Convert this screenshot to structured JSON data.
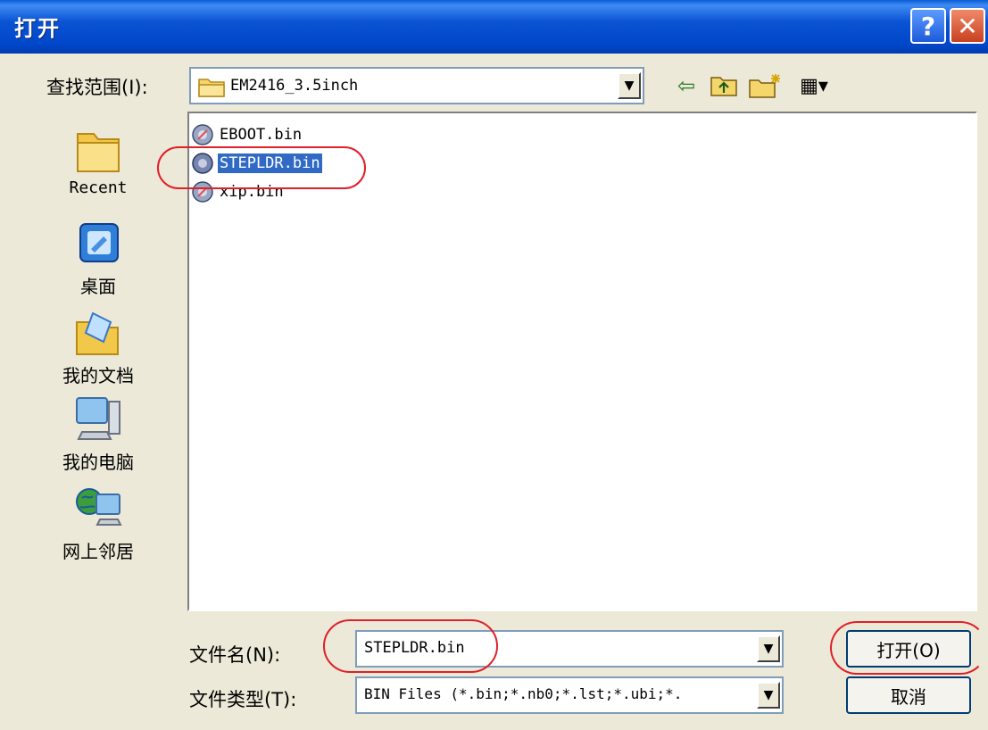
{
  "window": {
    "title": "打开",
    "help_glyph": "?",
    "close_glyph": "✕"
  },
  "lookin": {
    "label": "查找范围(I):",
    "value": "EM2416_3.5inch",
    "dropdown_glyph": "▼"
  },
  "toolbar": {
    "back_glyph": "⇦",
    "up_glyph": "⮤",
    "newfolder_glyph": "✱",
    "view_glyph": "▦▾"
  },
  "places": [
    {
      "label": "Recent",
      "icon": "folder-icon"
    },
    {
      "label": "桌面",
      "icon": "desktop-icon"
    },
    {
      "label": "我的文档",
      "icon": "documents-folder-icon"
    },
    {
      "label": "我的电脑",
      "icon": "computer-icon"
    },
    {
      "label": "网上邻居",
      "icon": "network-icon"
    }
  ],
  "files": [
    {
      "name": "EBOOT.bin",
      "selected": false
    },
    {
      "name": "STEPLDR.bin",
      "selected": true
    },
    {
      "name": "xip.bin",
      "selected": false
    }
  ],
  "filename": {
    "label": "文件名(N):",
    "value": "STEPLDR.bin"
  },
  "filetype": {
    "label": "文件类型(T):",
    "value": "BIN Files (*.bin;*.nb0;*.lst;*.ubi;*."
  },
  "buttons": {
    "open": "打开(O)",
    "cancel": "取消"
  },
  "colors": {
    "annotation": "#e0202a",
    "selection": "#316ac5"
  }
}
